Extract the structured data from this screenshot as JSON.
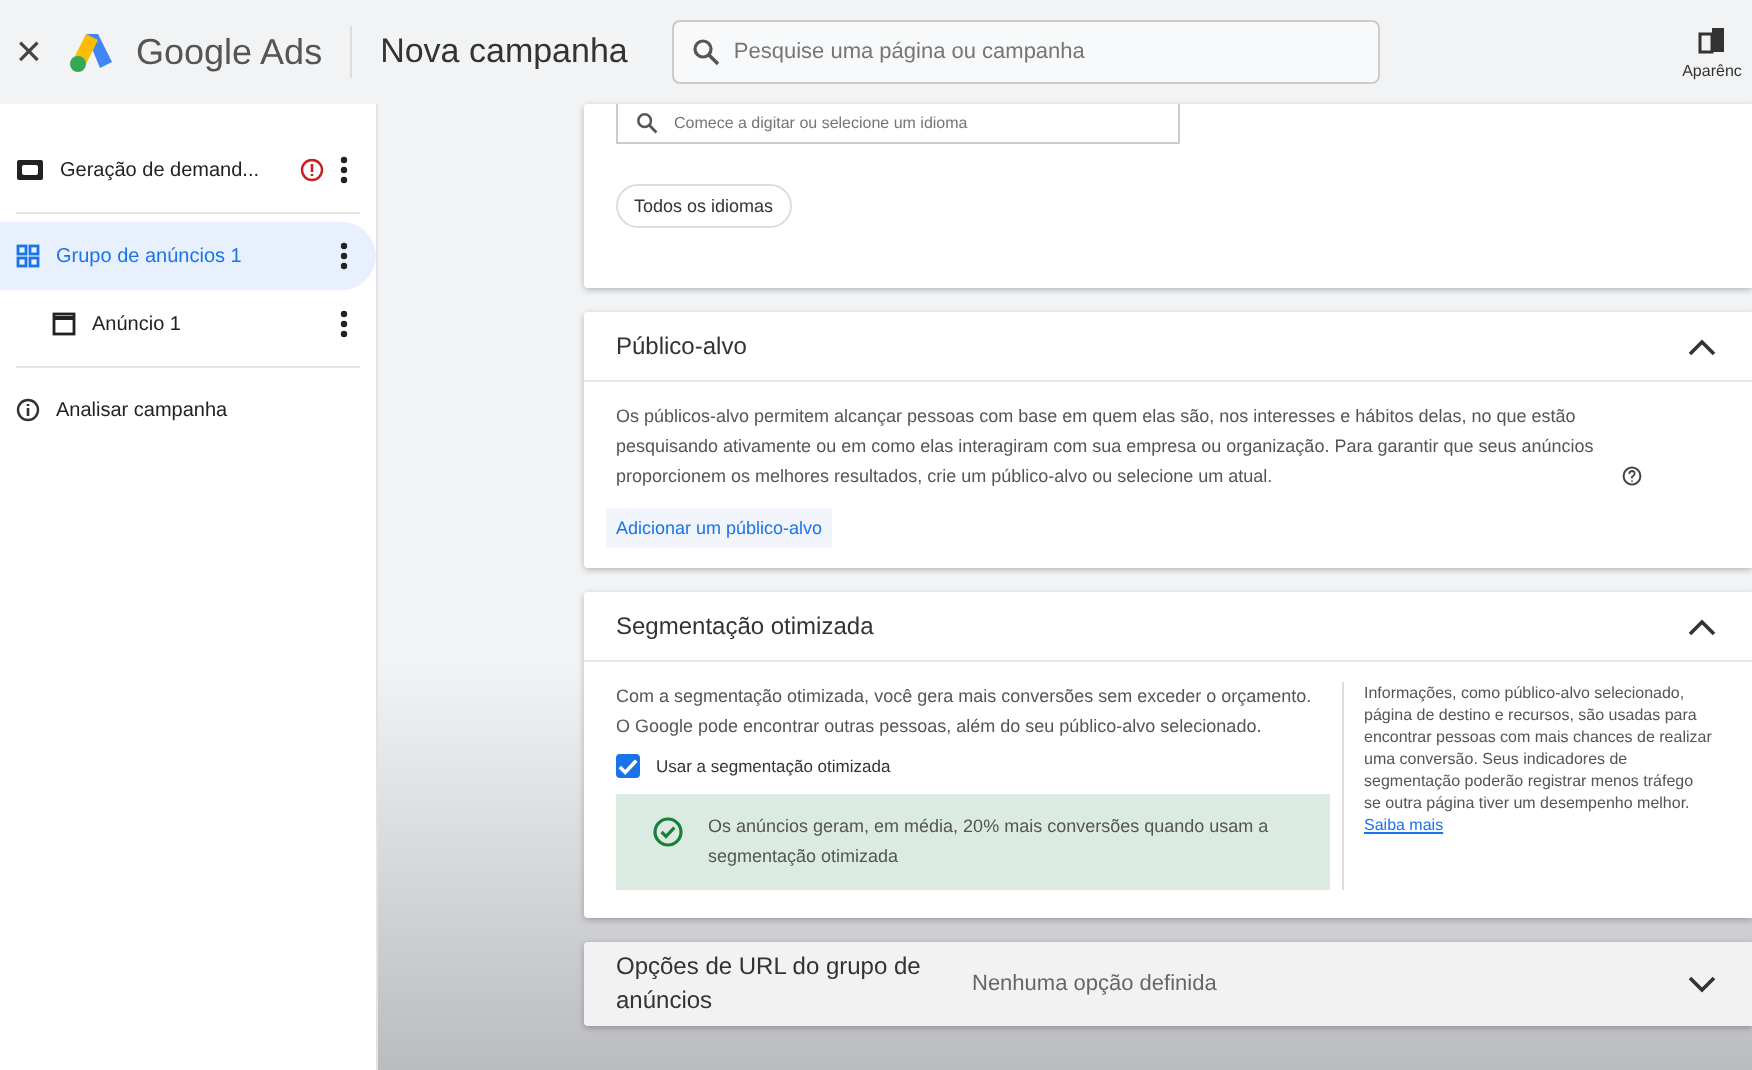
{
  "header": {
    "close": "×",
    "product": "Google Ads",
    "title": "Nova campanha",
    "search_placeholder": "Pesquise uma página ou campanha",
    "appearance_label": "Aparênc"
  },
  "sidebar": {
    "items": [
      {
        "kind": "campaign",
        "label": "Geração de demand...",
        "warning": true,
        "selected": false
      },
      {
        "kind": "ad_group",
        "label": "Grupo de anúncios 1",
        "warning": false,
        "selected": true,
        "children": [
          {
            "kind": "ad",
            "label": "Anúncio 1",
            "selected": false
          }
        ]
      },
      {
        "kind": "review",
        "label": "Analisar campanha",
        "warning": false,
        "selected": false
      }
    ]
  },
  "languages": {
    "placeholder": "Comece a digitar ou selecione um idioma",
    "chip": "Todos os idiomas"
  },
  "audience": {
    "title": "Público-alvo",
    "expanded": true,
    "description": "Os públicos-alvo permitem alcançar pessoas com base em quem elas são, nos interesses e hábitos delas, no que estão pesquisando ativamente ou em como elas interagiram com sua empresa ou organização. Para garantir que seus anúncios proporcionem os melhores resultados, crie um público-alvo ou selecione um atual.",
    "add_link": "Adicionar um público-alvo"
  },
  "optimized": {
    "title": "Segmentação otimizada",
    "expanded": true,
    "description": "Com a segmentação otimizada, você gera mais conversões sem exceder o orçamento. O Google pode encontrar outras pessoas, além do seu público-alvo selecionado.",
    "checkbox_label": "Usar a segmentação otimizada",
    "checked": true,
    "notice": "Os anúncios geram, em média, 20% mais conversões quando usam a segmentação otimizada",
    "side_note": "Informações, como público-alvo selecionado, página de destino e recursos, são usadas para encontrar pessoas com mais chances de realizar uma conversão. Seus indicadores de segmentação poderão registrar menos tráfego se outra página tiver um desempenho melhor.",
    "learn_more": "Saiba mais"
  },
  "url_options": {
    "title": "Opções de URL do grupo de anúncios",
    "value": "Nenhuma opção definida",
    "expanded": false
  }
}
